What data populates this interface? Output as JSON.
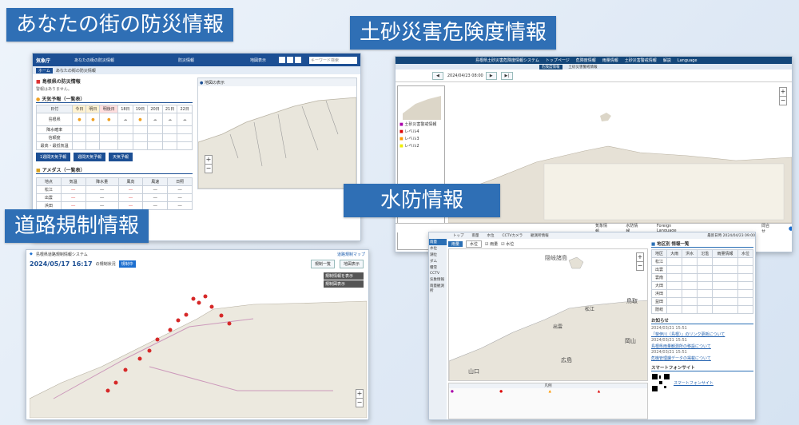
{
  "labels": {
    "bousai": "あなたの街の防災情報",
    "dosha": "土砂災害危険度情報",
    "suibou": "水防情報",
    "douro": "道路規制情報"
  },
  "bousai": {
    "logo": "気象庁",
    "site_title": "あなたの街の防災情報",
    "search_placeholder": "キーワード検索",
    "tabs": [
      "防災情報",
      "地図表示"
    ],
    "breadcrumb": [
      "ホーム",
      "あなたの街の防災情報"
    ],
    "warning_heading": "島根県の防災情報",
    "warning_sub": "警報はありません。",
    "forecast_heading": "天気予報（一覧表）",
    "forecast_cols": [
      "日付",
      "今日",
      "明日",
      "明後日",
      "18日",
      "19日",
      "20日",
      "21日",
      "22日"
    ],
    "forecast_rows": [
      "島根県",
      "降水確率",
      "信頼度",
      "最高・最低気温"
    ],
    "buttons": [
      "1週間天気予報",
      "週間天気予報",
      "天気予報"
    ],
    "amedas_heading": "アメダス（一覧表）",
    "amedas_cols": [
      "地点",
      "気温",
      "降水量",
      "風向",
      "風速",
      "日照"
    ],
    "amedas_rows": [
      "松江",
      "出雲",
      "浜田"
    ],
    "map_title": "地図の表示"
  },
  "dosha": {
    "system_title": "島根県土砂災害危険度情報システム",
    "nav": [
      "トップページ",
      "危険度情報",
      "雨量情報",
      "土砂災害警戒情報",
      "解説",
      "Language"
    ],
    "subtabs": [
      "危険度情報",
      "土砂災害警戒情報"
    ],
    "timestamp": "2024/04/23 08:00",
    "legend_items": [
      "土砂災害警戒情報",
      "レベル4",
      "レベル3",
      "レベル2"
    ],
    "footer_nav": [
      "気象情報",
      "水防情報",
      "Foreign Language"
    ],
    "help": "問合せ"
  },
  "suibou": {
    "menu": [
      "トップ",
      "雨量",
      "水位",
      "CCTVカメラ",
      "観測所情報"
    ],
    "side_menu": [
      "雨量",
      "水位",
      "潮位",
      "ダム",
      "積雪",
      "CCTV",
      "気象情報",
      "雨量観測所"
    ],
    "tabs": [
      "雨量",
      "水位"
    ],
    "checks": [
      "雨量",
      "水位"
    ],
    "update": "最新日時 2024/04/23 09:00",
    "list_heading": "地区別 情報一覧",
    "list_cols": [
      "地区",
      "大雨",
      "洪水",
      "氾濫",
      "雨量情報",
      "水位"
    ],
    "list_rows": [
      "松江",
      "出雲",
      "雲南",
      "大田",
      "浜田",
      "益田",
      "隠岐"
    ],
    "notice_heading": "お知らせ",
    "notices": [
      "2024/03/21 15:51",
      "「斐伊川（島根）」のリンク更新について",
      "2024/03/21 15:51",
      "島根県雨量観測所の移設について",
      "2024/03/21 15:51",
      "危機管理課データの掲載について"
    ],
    "smartphone_heading": "スマートフォンサイト",
    "smartphone_text": "スマートフォンサイト",
    "legend_heading": "凡例",
    "map_labels": [
      "隠岐諸島",
      "松江",
      "出雲",
      "鳥取",
      "岡山",
      "広島",
      "山口"
    ]
  },
  "douro": {
    "system_title": "島根県道路規制情報システム",
    "datetime": "2024/05/17 16:17",
    "status": "の規制状況",
    "badge": "規制中",
    "right_links": [
      "規制箇所一覧",
      "通行止め"
    ],
    "top_link": "道路規制マップ",
    "buttons": [
      "規制一覧",
      "地図表示"
    ],
    "panel": [
      "規制情報を表示",
      "規制図表示"
    ]
  }
}
